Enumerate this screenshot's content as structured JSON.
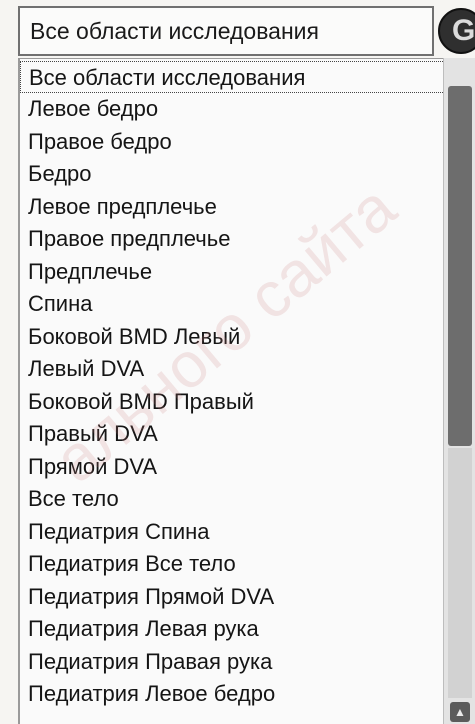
{
  "select": {
    "value": "Все области исследования"
  },
  "button": {
    "glyph": "G"
  },
  "list": {
    "selected_index": 0,
    "items": [
      "Все области исследования",
      "Левое бедро",
      "Правое бедро",
      "Бедро",
      "Левое предплечье",
      "Правое предплечье",
      "Предплечье",
      "Спина",
      "Боковой BMD Левый",
      "Левый DVA",
      "Боковой BMD Правый",
      "Правый DVA",
      "Прямой DVA",
      "Все тело",
      "Педиатрия Спина",
      "Педиатрия Все тело",
      "Педиатрия Прямой DVA",
      "Педиатрия Левая рука",
      "Педиатрия Правая рука",
      "Педиатрия Левое бедро"
    ]
  },
  "scrollbar": {
    "up_icon": "▲",
    "down_icon": "▼"
  },
  "watermark": {
    "text": "ального сайта"
  }
}
